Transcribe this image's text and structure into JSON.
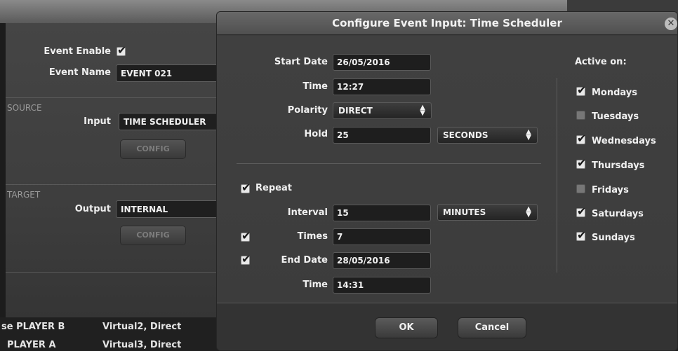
{
  "background_window": {
    "event_enable_label": "Event Enable",
    "event_name_label": "Event Name",
    "event_name_value": "EVENT 021",
    "source_section": "SOURCE",
    "input_label": "Input",
    "input_value": "TIME SCHEDULER",
    "source_config_button": "CONFIG",
    "target_section": "TARGET",
    "output_label": "Output",
    "output_value": "INTERNAL",
    "target_config_button": "CONFIG",
    "rows": [
      {
        "name": "se PLAYER B",
        "value": "Virtual2, Direct"
      },
      {
        "name": "PLAYER A",
        "value": "Virtual3, Direct"
      }
    ]
  },
  "dialog": {
    "title": "Configure Event Input: Time Scheduler",
    "start_date_label": "Start Date",
    "start_date_value": "26/05/2016",
    "time_label": "Time",
    "time_value": "12:27",
    "polarity_label": "Polarity",
    "polarity_value": "DIRECT",
    "hold_label": "Hold",
    "hold_value": "25",
    "hold_unit": "SECONDS",
    "repeat_label": "Repeat",
    "repeat_checked": true,
    "interval_label": "Interval",
    "interval_value": "15",
    "interval_unit": "MINUTES",
    "times_label": "Times",
    "times_value": "7",
    "times_checked": true,
    "end_date_label": "End Date",
    "end_date_value": "28/05/2016",
    "end_date_checked": true,
    "end_time_label": "Time",
    "end_time_value": "14:31",
    "active_on_label": "Active on:",
    "days": [
      {
        "label": "Mondays",
        "checked": true
      },
      {
        "label": "Tuesdays",
        "checked": false
      },
      {
        "label": "Wednesdays",
        "checked": true
      },
      {
        "label": "Thursdays",
        "checked": true
      },
      {
        "label": "Fridays",
        "checked": false
      },
      {
        "label": "Saturdays",
        "checked": true
      },
      {
        "label": "Sundays",
        "checked": true
      }
    ],
    "ok_button": "OK",
    "cancel_button": "Cancel"
  }
}
